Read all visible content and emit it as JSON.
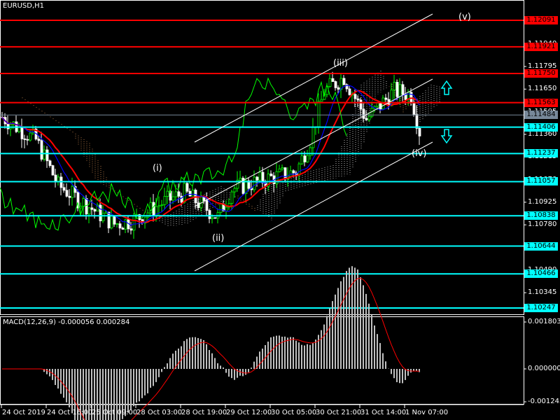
{
  "window": {
    "title": "EURUSD,H1"
  },
  "macd": {
    "title": "MACD(12,26,9) -0.000056 0.000284",
    "axis": [
      "0.001803",
      "0.000000",
      "-0.001245"
    ],
    "max": 0.001803,
    "min": -0.001245
  },
  "price_axis": [
    "1.11940",
    "1.11795",
    "1.11650",
    "1.11505",
    "1.11360",
    "1.11215",
    "1.11070",
    "1.10925",
    "1.10780",
    "1.10490",
    "1.10345"
  ],
  "price_range": {
    "top": 1.12091,
    "bottom": 1.10247
  },
  "levels": [
    {
      "price": "1.12091",
      "color": "#ff0000",
      "text": "#ff0000"
    },
    {
      "price": "1.11921",
      "color": "#ff0000",
      "text": "#ff0000"
    },
    {
      "price": "1.11750",
      "color": "#ff0000",
      "text": "#ff0000"
    },
    {
      "price": "1.11563",
      "color": "#ff0000",
      "text": "#ff0000"
    },
    {
      "price": "1.11406",
      "color": "#00ffff",
      "text": "#00ffff"
    },
    {
      "price": "1.11237",
      "color": "#00ffff",
      "text": "#00ffff"
    },
    {
      "price": "1.11057",
      "color": "#00ffff",
      "text": "#00ffff"
    },
    {
      "price": "1.10838",
      "color": "#00ffff",
      "text": "#00ffff"
    },
    {
      "price": "1.10644",
      "color": "#00ffff",
      "text": "#00ffff"
    },
    {
      "price": "1.10466",
      "color": "#00ffff",
      "text": "#00ffff"
    },
    {
      "price": "1.10247",
      "color": "#00ffff",
      "text": "#00ffff"
    }
  ],
  "current_price": {
    "price": "1.11484",
    "color": "#778899"
  },
  "time_axis": [
    "24 Oct 2019",
    "24 Oct 16:00",
    "25 Oct 09:00",
    "28 Oct 03:00",
    "28 Oct 19:00",
    "29 Oct 12:00",
    "30 Oct 05:00",
    "30 Oct 21:00",
    "31 Oct 14:00",
    "1 Nov 07:00"
  ],
  "waves": [
    {
      "label": "(i)"
    },
    {
      "label": "(ii)"
    },
    {
      "label": "(iii)"
    },
    {
      "label": "(iv)"
    },
    {
      "label": "(v)"
    }
  ],
  "price_path": [
    [
      1,
      1.11458
    ],
    [
      12,
      1.11324
    ],
    [
      20,
      1.11032
    ],
    [
      40,
      1.10785
    ],
    [
      47,
      1.10808
    ],
    [
      57,
      1.1092
    ],
    [
      65,
      1.10987
    ],
    [
      77,
      1.1083
    ],
    [
      82,
      1.1101
    ],
    [
      95,
      1.11077
    ],
    [
      105,
      1.11122
    ],
    [
      110,
      1.11324
    ],
    [
      115,
      1.11638
    ],
    [
      122,
      1.11728
    ],
    [
      130,
      1.11458
    ],
    [
      135,
      1.11548
    ],
    [
      140,
      1.11638
    ],
    [
      146,
      1.11615
    ],
    [
      150,
      1.11301
    ]
  ],
  "colors": {
    "bull": "#00ff00",
    "bear": "#ffffff",
    "ma": "#ff0000",
    "kijun": "#0000ff",
    "chikou": "#00ff00",
    "cloud_bull": "#ffffff",
    "cloud_bear": "#f4a460",
    "channel": "#ffffff",
    "arrow": "#00ffff"
  }
}
